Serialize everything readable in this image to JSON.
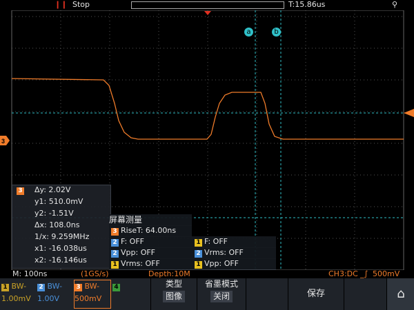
{
  "topbar": {
    "run_state": "Stop",
    "trigger_time": "T:15.86us"
  },
  "cursor_labels": {
    "a": "a",
    "b": "b"
  },
  "measure": {
    "channel": "3",
    "dy": "Δy: 2.02V",
    "y1": "y1: 510.0mV",
    "y2": "y2: -1.51V",
    "dx": "Δx: 108.0ns",
    "inv_x": "1/x: 9.259MHz",
    "x1": "x1: -16.038us",
    "x2": "x2: -16.146us"
  },
  "screen_measure": {
    "title": "屏幕测量",
    "rise": {
      "ch": "3",
      "text": "RiseT: 64.00ns"
    },
    "rows": [
      {
        "left_ch": "2",
        "left": "F: OFF",
        "right_ch": "1",
        "right": "F: OFF"
      },
      {
        "left_ch": "2",
        "left": "Vpp: OFF",
        "right_ch": "2",
        "right": "Vrms: OFF"
      },
      {
        "left_ch": "1",
        "left": "Vrms: OFF",
        "right_ch": "1",
        "right": "Vpp: OFF"
      }
    ]
  },
  "status": {
    "timebase": "M: 100ns",
    "sample_rate": "(1GS/s)",
    "depth": "Depth:10M",
    "channel_info": "CH3:DC",
    "trigger_level": "500mV"
  },
  "channels": [
    {
      "num": "1",
      "bw": "BW-",
      "scale": "1.00mV",
      "color": "#c9a227"
    },
    {
      "num": "2",
      "bw": "BW-",
      "scale": "1.00V",
      "color": "#4a90d9"
    },
    {
      "num": "3",
      "bw": "BW-",
      "scale": "500mV",
      "color": "#f07c2a"
    },
    {
      "num": "4",
      "bw": "",
      "scale": "",
      "color": "#3a9a3a"
    }
  ],
  "buttons": {
    "type_label": "类型",
    "type_value": "图像",
    "save_mode_label": "省墨模式",
    "save_mode_value": "关闭",
    "save": "保存"
  },
  "colors": {
    "ch3": "#f07c2a",
    "ch2": "#4a90d9",
    "ch1": "#e8c020",
    "cursor": "#30c0c8",
    "trigger": "#e03020"
  }
}
